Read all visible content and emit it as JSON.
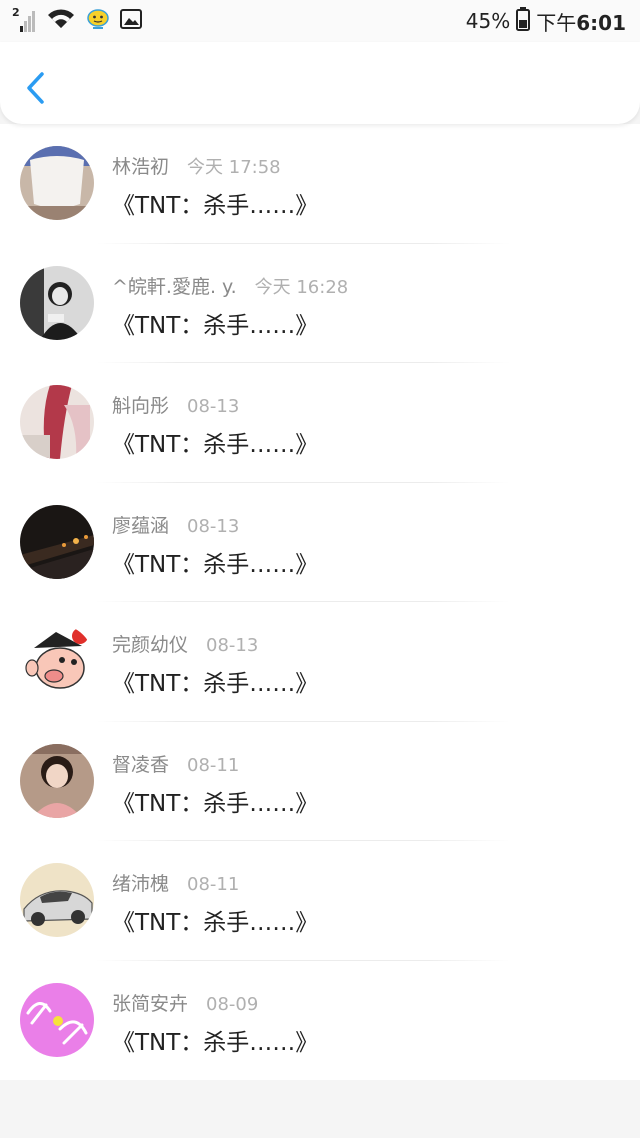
{
  "status_bar": {
    "sim_badge": "2",
    "battery": "45%",
    "time_prefix": "下午",
    "time": "6:01"
  },
  "header": {
    "back_icon": "chevron-left-icon",
    "accent": "#2b9cf2"
  },
  "messages": [
    {
      "name": "林浩初",
      "time": "今天 17:58",
      "text": "《TNT：杀手……》"
    },
    {
      "name": "^皖軒.愛鹿. y.",
      "time": "今天 16:28",
      "text": "《TNT：杀手……》"
    },
    {
      "name": "斛向彤",
      "time": "08-13",
      "text": "《TNT：杀手……》"
    },
    {
      "name": "廖蕴涵",
      "time": "08-13",
      "text": "《TNT：杀手……》"
    },
    {
      "name": "完颜幼仪",
      "time": "08-13",
      "text": "《TNT：杀手……》"
    },
    {
      "name": "督凌香",
      "time": "08-11",
      "text": "《TNT：杀手……》"
    },
    {
      "name": "绪沛槐",
      "time": "08-11",
      "text": "《TNT：杀手……》"
    },
    {
      "name": "张简安卉",
      "time": "08-09",
      "text": "《TNT：杀手……》"
    }
  ]
}
